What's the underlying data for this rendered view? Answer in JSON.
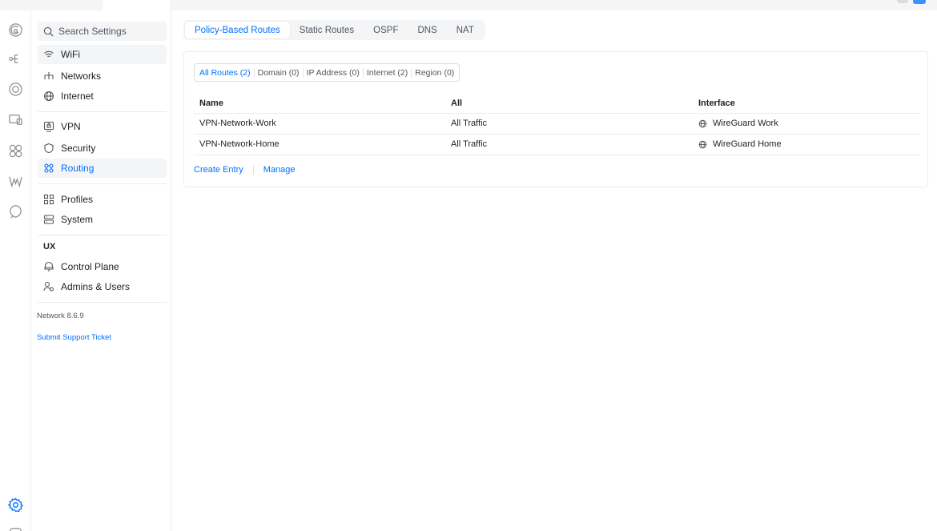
{
  "search": {
    "placeholder": "Search Settings"
  },
  "sidebar": {
    "items": [
      {
        "label": "WiFi",
        "icon": "wifi-icon"
      },
      {
        "label": "Networks",
        "icon": "networks-icon"
      },
      {
        "label": "Internet",
        "icon": "globe-icon"
      },
      {
        "label": "VPN",
        "icon": "vpn-icon"
      },
      {
        "label": "Security",
        "icon": "shield-icon"
      },
      {
        "label": "Routing",
        "icon": "routing-icon"
      },
      {
        "label": "Profiles",
        "icon": "profiles-icon"
      },
      {
        "label": "System",
        "icon": "server-icon"
      }
    ],
    "section_ux": "UX",
    "ux_items": [
      {
        "label": "Control Plane",
        "icon": "control-plane-icon"
      },
      {
        "label": "Admins & Users",
        "icon": "admins-icon"
      }
    ],
    "version": "Network 8.6.9",
    "support_link": "Submit Support Ticket"
  },
  "tabs": [
    {
      "label": "Policy-Based Routes",
      "active": true
    },
    {
      "label": "Static Routes"
    },
    {
      "label": "OSPF"
    },
    {
      "label": "DNS"
    },
    {
      "label": "NAT"
    }
  ],
  "filters": [
    {
      "label": "All Routes (2)",
      "active": true
    },
    {
      "label": "Domain (0)"
    },
    {
      "label": "IP Address (0)"
    },
    {
      "label": "Internet (2)"
    },
    {
      "label": "Region (0)"
    }
  ],
  "table": {
    "headers": [
      "Name",
      "All",
      "Interface"
    ],
    "rows": [
      {
        "name": "VPN-Network-Work",
        "scope": "All Traffic",
        "interface": "WireGuard Work"
      },
      {
        "name": "VPN-Network-Home",
        "scope": "All Traffic",
        "interface": "WireGuard Home"
      }
    ]
  },
  "actions": {
    "create": "Create Entry",
    "manage": "Manage"
  },
  "colors": {
    "accent": "#006fff",
    "text": "#212327",
    "muted": "#50565e",
    "border": "#ececee"
  }
}
